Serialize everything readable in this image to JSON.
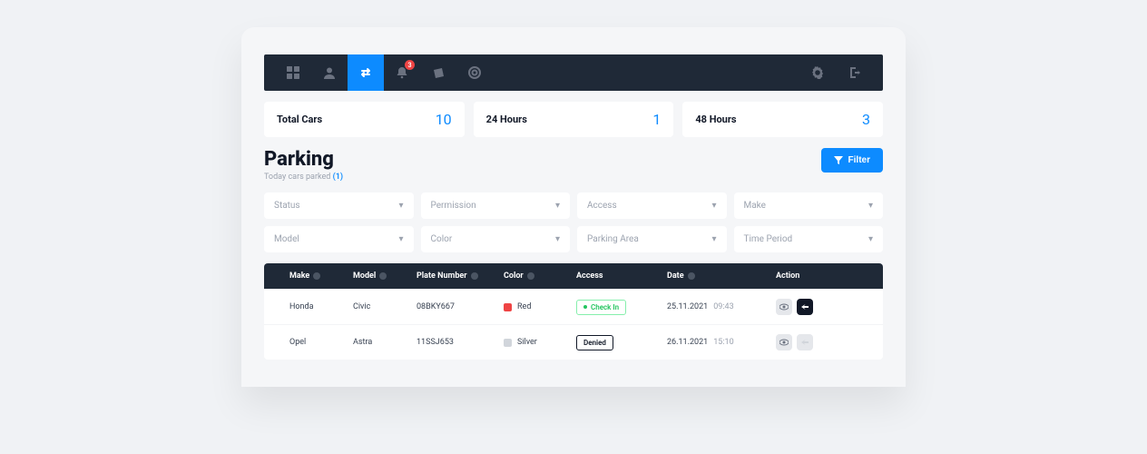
{
  "nav": {
    "notification_badge": "3"
  },
  "stats": [
    {
      "label": "Total Cars",
      "value": "10"
    },
    {
      "label": "24 Hours",
      "value": "1"
    },
    {
      "label": "48 Hours",
      "value": "3"
    }
  ],
  "header": {
    "title": "Parking",
    "subtitle_text": "Today cars parked",
    "subtitle_count": "(1)",
    "filter_button": "Filter"
  },
  "filters": [
    {
      "label": "Status"
    },
    {
      "label": "Permission"
    },
    {
      "label": "Access"
    },
    {
      "label": "Make"
    },
    {
      "label": "Model"
    },
    {
      "label": "Color"
    },
    {
      "label": "Parking Area"
    },
    {
      "label": "Time Period"
    }
  ],
  "table": {
    "headers": {
      "make": "Make",
      "model": "Model",
      "plate": "Plate Number",
      "color": "Color",
      "access": "Access",
      "date": "Date",
      "action": "Action"
    },
    "rows": [
      {
        "make": "Honda",
        "model": "Civic",
        "plate": "08BKY667",
        "color_name": "Red",
        "color_hex": "#ef4444",
        "access_label": "Check In",
        "access_kind": "checkin",
        "date": "25.11.2021",
        "time": "09:43",
        "arrow_kind": "dark"
      },
      {
        "make": "Opel",
        "model": "Astra",
        "plate": "11SSJ653",
        "color_name": "Silver",
        "color_hex": "#d1d5db",
        "access_label": "Denied",
        "access_kind": "denied",
        "date": "26.11.2021",
        "time": "15:10",
        "arrow_kind": "light"
      }
    ]
  }
}
